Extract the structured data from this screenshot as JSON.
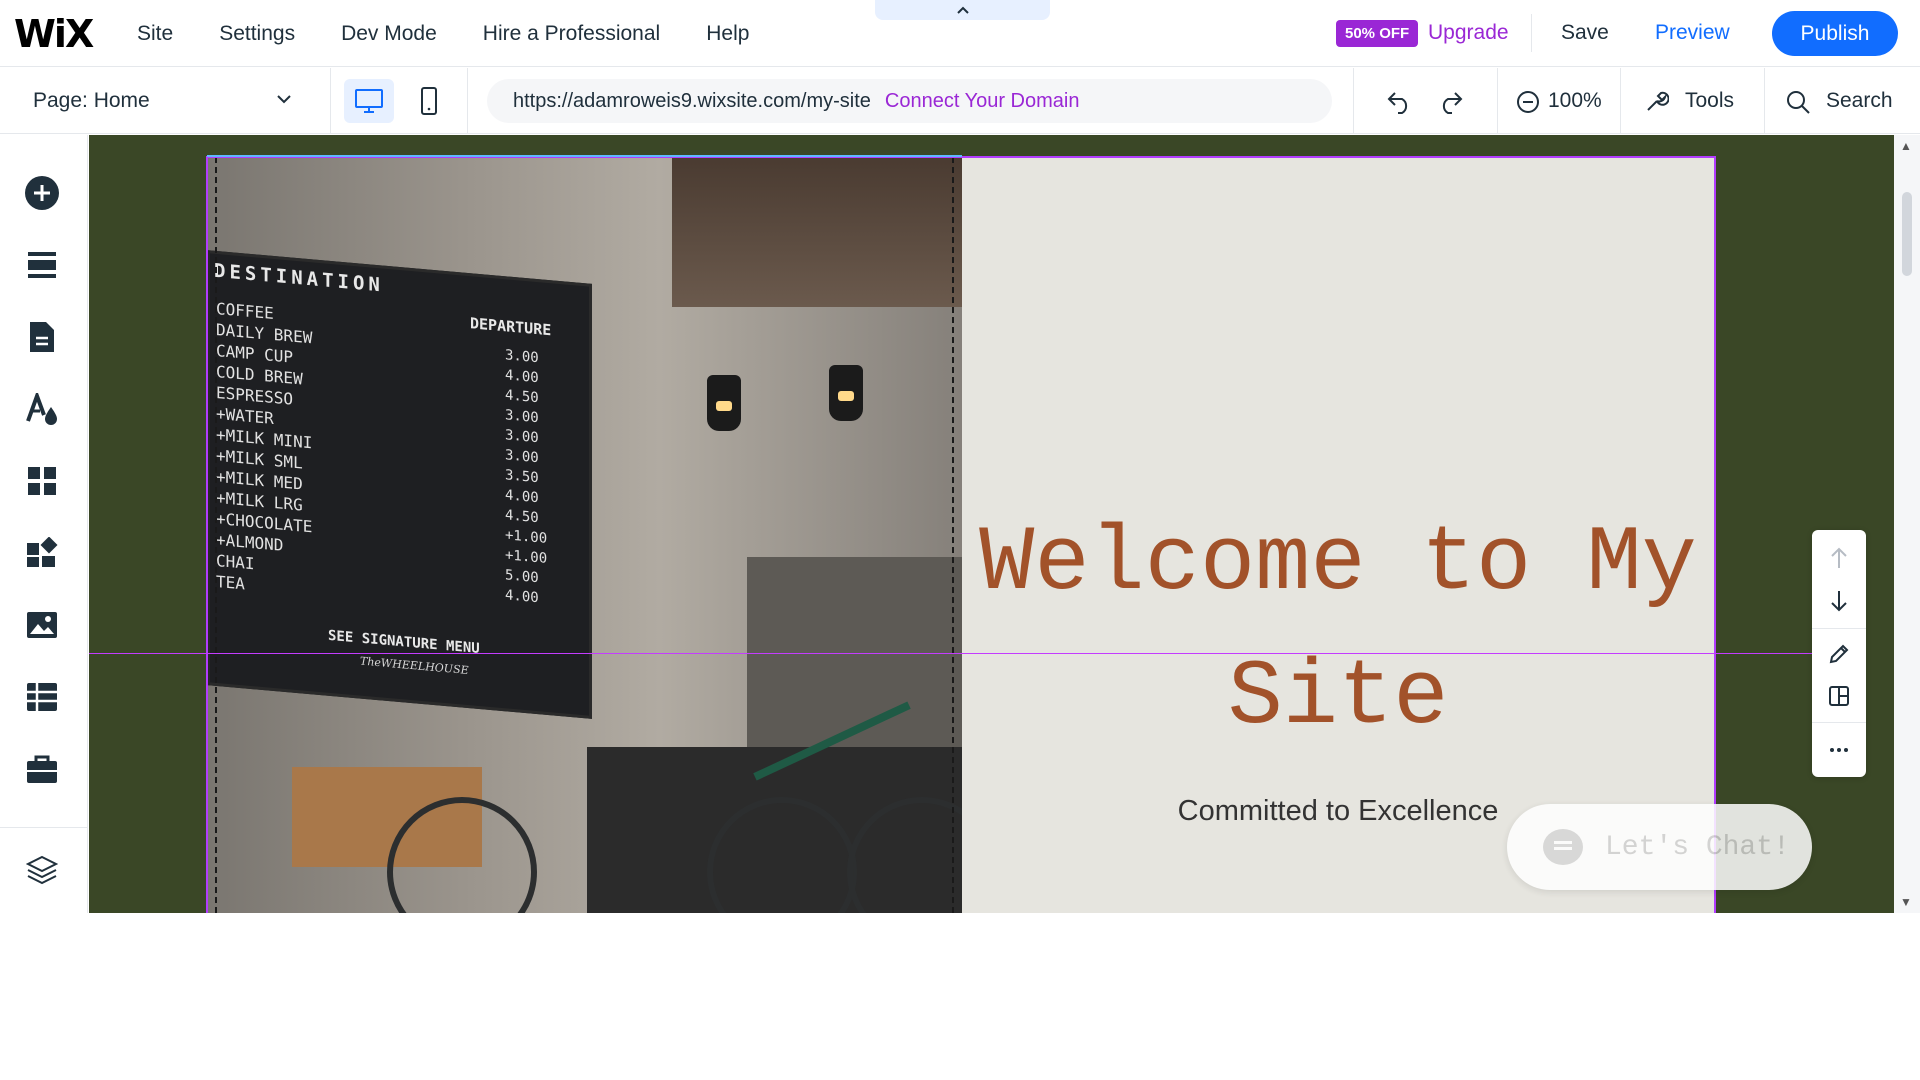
{
  "header": {
    "logo": "WiX",
    "menu": [
      "Site",
      "Settings",
      "Dev Mode",
      "Hire a Professional",
      "Help"
    ],
    "collapse_icon": "chevron-up-icon",
    "badge": "50% OFF",
    "upgrade": "Upgrade",
    "save": "Save",
    "preview": "Preview",
    "publish": "Publish",
    "colors": {
      "accent": "#116dff",
      "premium": "#9a27d5"
    }
  },
  "toolbar": {
    "page_label": "Page: Home",
    "url": "https://adamroweis9.wixsite.com/my-site",
    "connect_domain": "Connect Your Domain",
    "zoom": "100%",
    "tools": "Tools",
    "search": "Search",
    "devices": [
      "desktop-icon",
      "mobile-icon"
    ],
    "active_device": "desktop"
  },
  "left_panel": {
    "icons": [
      "add-icon",
      "sections-icon",
      "pages-icon",
      "theme-icon",
      "apps-icon",
      "business-icon",
      "media-icon",
      "cms-icon",
      "portfolio-icon",
      "layers-icon"
    ]
  },
  "canvas": {
    "heading": "Welcome to My Site",
    "tagline": "Committed to Excellence",
    "chalkboard": {
      "title": "DESTINATION",
      "column": "DEPARTURE",
      "items": [
        "COFFEE",
        "DAILY BREW",
        "CAMP CUP",
        "COLD BREW",
        "ESPRESSO",
        "+WATER",
        "+MILK  MINI",
        "+MILK  SML",
        "+MILK  MED",
        "+MILK  LRG",
        "+CHOCOLATE",
        "+ALMOND",
        "CHAI",
        "TEA"
      ],
      "prices": [
        "3.00",
        "4.00",
        "4.50",
        "3.00",
        "3.00",
        "3.00",
        "3.50",
        "4.00",
        "4.50",
        "+1.00",
        "+1.00",
        "5.00",
        "4.00"
      ],
      "footer": "SEE SIGNATURE MENU",
      "brand": "TheWHEELHOUSE"
    },
    "colors": {
      "background": "#3a4726",
      "panel": "#e6e5df",
      "heading": "#a2522a"
    },
    "chat": "Let's Chat!"
  },
  "right_tools": [
    "arrow-up-icon",
    "arrow-down-icon",
    "pencil-icon",
    "layout-icon",
    "more-icon"
  ]
}
